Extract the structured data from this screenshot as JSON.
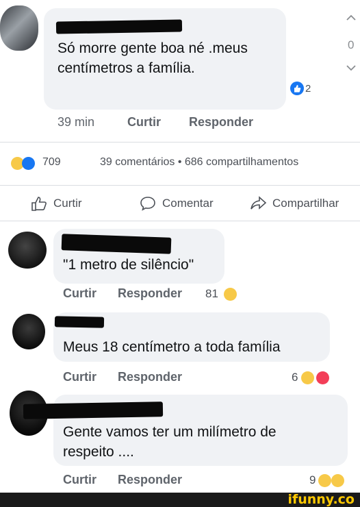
{
  "post": {
    "comment_text": "Só morre gente boa né .meus centímetros a família.",
    "reaction_count": "2",
    "time": "39 min",
    "like_label": "Curtir",
    "reply_label": "Responder",
    "side_number": "0"
  },
  "stats": {
    "reactions_total": "709",
    "comments_shares": "39 comentários • 686 compartilhamentos"
  },
  "actions": {
    "like": "Curtir",
    "comment": "Comentar",
    "share": "Compartilhar"
  },
  "comments": [
    {
      "text": "\"1 metro de silêncio\"",
      "like_label": "Curtir",
      "reply_label": "Responder",
      "reaction_count": "81"
    },
    {
      "text": "Meus 18 centímetro a toda família",
      "like_label": "Curtir",
      "reply_label": "Responder",
      "reaction_count": "6"
    },
    {
      "text": "Gente vamos ter um milímetro de respeito ....",
      "like_label": "Curtir",
      "reply_label": "Responder",
      "reaction_count": "9"
    }
  ],
  "footer": {
    "brand": "ifunny.co"
  },
  "colors": {
    "like_blue": "#1877f2",
    "haha_yellow": "#f7c948",
    "love_red": "#f33e58",
    "brand_yellow": "#ffc800"
  }
}
